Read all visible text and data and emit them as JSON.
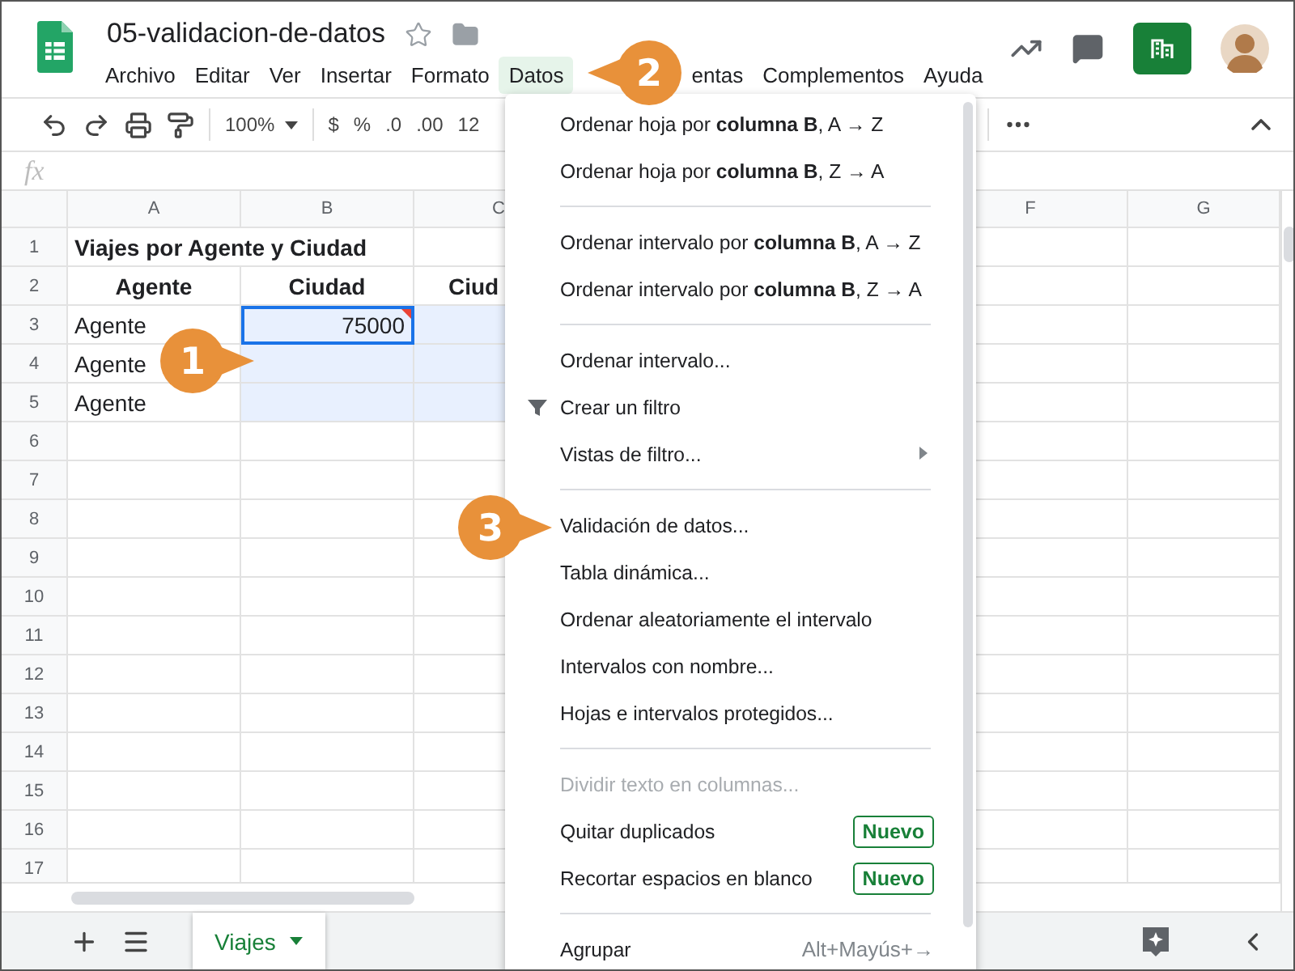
{
  "document": {
    "title": "05-validacion-de-datos"
  },
  "menu_bar": [
    {
      "label": "Archivo",
      "selected": false
    },
    {
      "label": "Editar",
      "selected": false
    },
    {
      "label": "Ver",
      "selected": false
    },
    {
      "label": "Insertar",
      "selected": false
    },
    {
      "label": "Formato",
      "selected": false
    },
    {
      "label": "Datos",
      "selected": true
    },
    {
      "label": "entas",
      "selected": false
    },
    {
      "label": "Complementos",
      "selected": false
    },
    {
      "label": "Ayuda",
      "selected": false
    }
  ],
  "toolbar": {
    "zoom": "100%",
    "currency": "$",
    "percent": "%",
    "decimals_less": ".0",
    "decimals_more": ".00",
    "number_format": "12"
  },
  "formula_bar": {
    "label": "fx"
  },
  "column_headers": [
    "A",
    "B",
    "C",
    "F",
    "G"
  ],
  "rows": [
    {
      "number": "1",
      "cells": [
        {
          "text": "Viajes por Agente y Ciudad",
          "kind": "title",
          "selected": false,
          "active": false,
          "invalid": false
        }
      ]
    },
    {
      "number": "2",
      "cells": [
        {
          "text": "Agente",
          "kind": "header",
          "selected": false,
          "active": false,
          "invalid": false
        },
        {
          "text": "Ciudad",
          "kind": "header",
          "selected": false,
          "active": false,
          "invalid": false
        },
        {
          "text": "Ciud",
          "kind": "header",
          "selected": false,
          "active": false
        }
      ]
    },
    {
      "number": "3",
      "cells": [
        {
          "text": "Agente",
          "kind": "text",
          "selected": false,
          "active": false,
          "invalid": false
        },
        {
          "text": "75000",
          "kind": "number",
          "selected": true,
          "active": true,
          "invalid": true
        },
        {
          "kind": "text",
          "selected": true,
          "active": false
        }
      ]
    },
    {
      "number": "4",
      "cells": [
        {
          "text": "Agente",
          "kind": "text",
          "selected": false,
          "active": false,
          "invalid": false
        },
        {
          "kind": "text",
          "selected": true,
          "active": false,
          "invalid": false
        },
        {
          "kind": "text",
          "selected": true,
          "active": false
        }
      ]
    },
    {
      "number": "5",
      "cells": [
        {
          "text": "Agente",
          "kind": "text",
          "selected": false,
          "active": false,
          "invalid": false
        },
        {
          "kind": "text",
          "selected": true,
          "active": false,
          "invalid": false
        },
        {
          "kind": "text",
          "selected": true,
          "active": false
        }
      ]
    },
    {
      "number": "6"
    },
    {
      "number": "7"
    },
    {
      "number": "8"
    },
    {
      "number": "9"
    },
    {
      "number": "10"
    },
    {
      "number": "11"
    },
    {
      "number": "12"
    },
    {
      "number": "13"
    },
    {
      "number": "14"
    },
    {
      "number": "15"
    },
    {
      "number": "16"
    },
    {
      "number": "17"
    }
  ],
  "data_menu": [
    {
      "kind": "item",
      "label": "Ordenar hoja por **columna B**, A → Z",
      "disabled": false,
      "submenu": false
    },
    {
      "kind": "item",
      "label": "Ordenar hoja por **columna B**, Z → A",
      "disabled": false,
      "submenu": false
    },
    {
      "kind": "separator"
    },
    {
      "kind": "item",
      "label": "Ordenar intervalo por **columna B**, A → Z",
      "disabled": false,
      "submenu": false
    },
    {
      "kind": "item",
      "label": "Ordenar intervalo por **columna B**, Z → A",
      "disabled": false,
      "submenu": false
    },
    {
      "kind": "separator"
    },
    {
      "kind": "item",
      "label": "Ordenar intervalo...",
      "disabled": false,
      "submenu": false
    },
    {
      "kind": "filter",
      "label": "Crear un filtro",
      "disabled": false,
      "submenu": false
    },
    {
      "kind": "item",
      "label": "Vistas de filtro...",
      "disabled": false,
      "submenu": true
    },
    {
      "kind": "separator"
    },
    {
      "kind": "item",
      "label": "Validación de datos...",
      "disabled": false,
      "submenu": false
    },
    {
      "kind": "item",
      "label": "Tabla dinámica...",
      "disabled": false,
      "submenu": false
    },
    {
      "kind": "item",
      "label": "Ordenar aleatoriamente el intervalo",
      "disabled": false,
      "submenu": false
    },
    {
      "kind": "item",
      "label": "Intervalos con nombre...",
      "disabled": false,
      "submenu": false
    },
    {
      "kind": "item",
      "label": "Hojas e intervalos protegidos...",
      "disabled": false,
      "submenu": false
    },
    {
      "kind": "separator"
    },
    {
      "kind": "item",
      "label": "Dividir texto en columnas...",
      "disabled": true,
      "submenu": false
    },
    {
      "kind": "item",
      "label": "Quitar duplicados",
      "badge": "Nuevo",
      "disabled": false,
      "submenu": false
    },
    {
      "kind": "item",
      "label": "Recortar espacios en blanco",
      "badge": "Nuevo",
      "disabled": false,
      "submenu": false
    },
    {
      "kind": "separator"
    },
    {
      "kind": "item",
      "label": "Agrupar",
      "shortcut": "Alt+Mayús+→",
      "disabled": false,
      "submenu": false
    }
  ],
  "sheet_tabs": [
    {
      "label": "Viajes",
      "selected": true
    }
  ],
  "callouts": [
    {
      "number": "1"
    },
    {
      "number": "2"
    },
    {
      "number": "3"
    }
  ]
}
